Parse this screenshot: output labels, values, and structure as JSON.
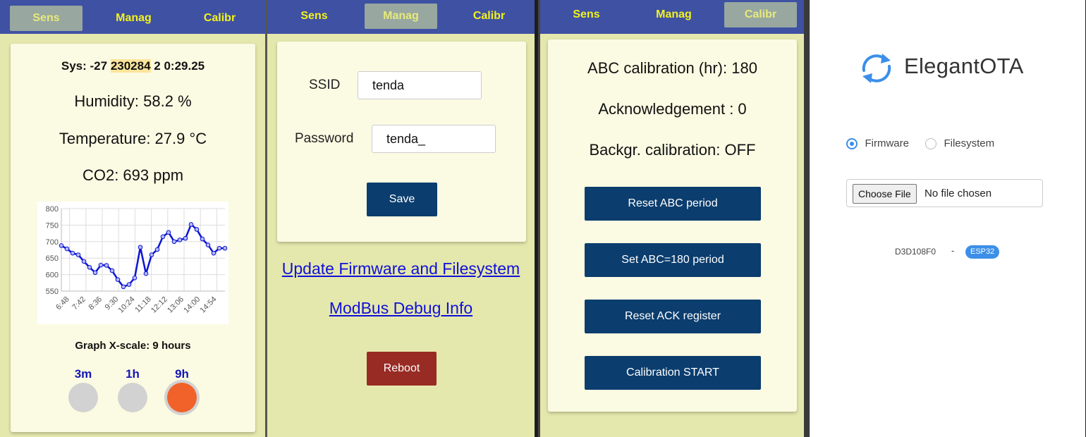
{
  "tabs": {
    "sens": "Sens",
    "manag": "Manag",
    "calibr": "Calibr"
  },
  "sens": {
    "sys_prefix": "Sys: -27 ",
    "sys_highlight": "230284",
    "sys_suffix": " 2 0:29.25",
    "humidity": "Humidity: 58.2 %",
    "temperature": "Temperature: 27.9 °C",
    "co2": "CO2: 693 ppm",
    "graph_scale": "Graph X-scale: 9 hours",
    "range_options": [
      "3m",
      "1h",
      "9h"
    ],
    "range_selected": "9h"
  },
  "chart_data": {
    "type": "line",
    "title": "",
    "xlabel": "",
    "ylabel": "",
    "ylim": [
      550,
      800
    ],
    "yticks": [
      800,
      750,
      700,
      650,
      600,
      550
    ],
    "x_tick_labels": [
      "6:48",
      "7:42",
      "8:36",
      "9:30",
      "10:24",
      "11:18",
      "12:12",
      "13:06",
      "14:00",
      "14:54"
    ],
    "series": [
      {
        "color": "#0a14d2",
        "values": [
          688,
          678,
          665,
          660,
          640,
          622,
          606,
          629,
          628,
          612,
          585,
          563,
          570,
          590,
          683,
          603,
          660,
          676,
          715,
          728,
          700,
          705,
          710,
          752,
          737,
          708,
          690,
          665,
          680,
          680
        ]
      }
    ]
  },
  "manag": {
    "ssid_label": "SSID",
    "ssid_value": "tenda",
    "password_label": "Password",
    "password_value": "tenda_",
    "save": "Save",
    "update_link": "Update Firmware and Filesystem",
    "debug_link": "ModBus Debug Info",
    "reboot": "Reboot"
  },
  "calibr": {
    "abc": "ABC calibration (hr): 180",
    "ack": "Acknowledgement : 0",
    "bg": "Backgr. calibration: OFF",
    "btn_reset_abc": "Reset ABC period",
    "btn_set_abc": "Set ABC=180 period",
    "btn_reset_ack": "Reset ACK register",
    "btn_cal_start": "Calibration START"
  },
  "ota": {
    "brand": "ElegantOTA",
    "opt_firmware": "Firmware",
    "opt_filesystem": "Filesystem",
    "selected": "Firmware",
    "choose_file": "Choose File",
    "no_file": "No file chosen",
    "device_id": "D3D108F0",
    "separator": "-",
    "badge": "ESP32",
    "accent": "#3b8fe8"
  }
}
